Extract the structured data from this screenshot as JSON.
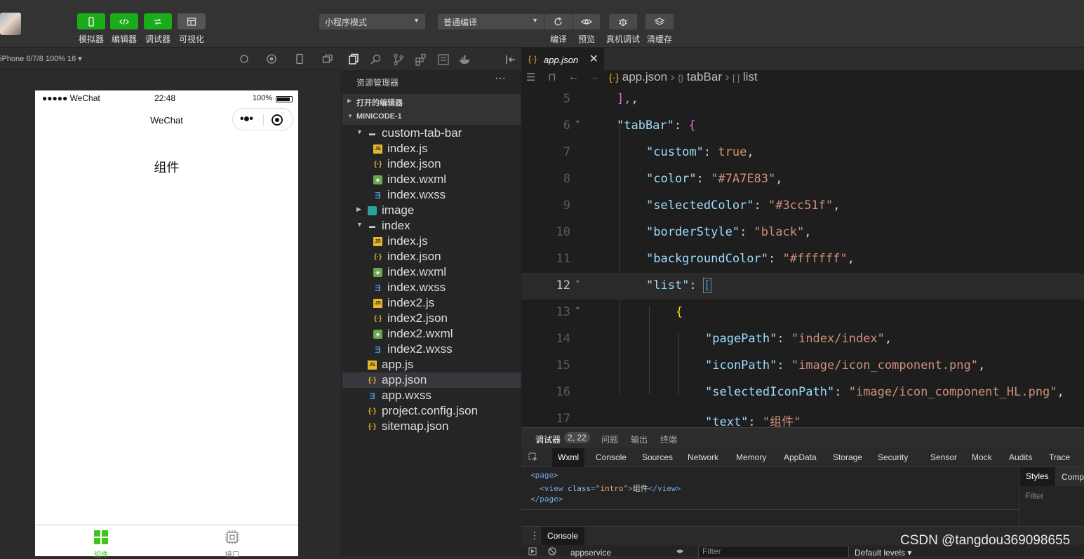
{
  "toolbar": {
    "buttons": [
      {
        "label": "模拟器",
        "icon": "phone-icon"
      },
      {
        "label": "编辑器",
        "icon": "code-icon"
      },
      {
        "label": "调试器",
        "icon": "debug-icon"
      },
      {
        "label": "可视化",
        "icon": "layout-icon"
      }
    ],
    "mode_select": "小程序模式",
    "compile_select": "普通编译",
    "actions": [
      {
        "label": "编译",
        "icon": "refresh-icon"
      },
      {
        "label": "预览",
        "icon": "eye-icon"
      },
      {
        "label": "真机调试",
        "icon": "bug-icon"
      },
      {
        "label": "清缓存",
        "icon": "layers-icon"
      }
    ]
  },
  "simulator": {
    "device": "iPhone 6/7/8 100% 16 ▾",
    "status": {
      "carrier": "●●●●● WeChat",
      "time": "22:48",
      "battery": "100%"
    },
    "nav_title": "WeChat",
    "content_text": "组件",
    "tabbar": [
      {
        "label": "组件",
        "color": "#3cc51f",
        "icon": "grid-icon"
      },
      {
        "label": "接口",
        "color": "#7A7E83",
        "icon": "chip-icon"
      }
    ]
  },
  "explorer": {
    "title": "资源管理器",
    "more": "···",
    "sections": [
      "打开的编辑器",
      "MINICODE-1"
    ],
    "tree": [
      {
        "name": "custom-tab-bar",
        "type": "folder",
        "level": 0,
        "expanded": true
      },
      {
        "name": "index.js",
        "type": "js",
        "level": 1
      },
      {
        "name": "index.json",
        "type": "json",
        "level": 1
      },
      {
        "name": "index.wxml",
        "type": "wxml",
        "level": 1
      },
      {
        "name": "index.wxss",
        "type": "wxss",
        "level": 1
      },
      {
        "name": "image",
        "type": "img",
        "level": 0,
        "expanded": false
      },
      {
        "name": "index",
        "type": "folder",
        "level": 0,
        "expanded": true
      },
      {
        "name": "index.js",
        "type": "js",
        "level": 1
      },
      {
        "name": "index.json",
        "type": "json",
        "level": 1
      },
      {
        "name": "index.wxml",
        "type": "wxml",
        "level": 1
      },
      {
        "name": "index.wxss",
        "type": "wxss",
        "level": 1
      },
      {
        "name": "index2.js",
        "type": "js",
        "level": 1
      },
      {
        "name": "index2.json",
        "type": "json",
        "level": 1
      },
      {
        "name": "index2.wxml",
        "type": "wxml",
        "level": 1
      },
      {
        "name": "index2.wxss",
        "type": "wxss",
        "level": 1
      },
      {
        "name": "app.js",
        "type": "js",
        "level": 0
      },
      {
        "name": "app.json",
        "type": "json",
        "level": 0,
        "selected": true
      },
      {
        "name": "app.wxss",
        "type": "wxss",
        "level": 0
      },
      {
        "name": "project.config.json",
        "type": "json",
        "level": 0
      },
      {
        "name": "sitemap.json",
        "type": "json",
        "level": 0
      }
    ]
  },
  "editor": {
    "tab": "app.json",
    "breadcrumb": [
      "app.json",
      "tabBar",
      "list"
    ],
    "lines": [
      {
        "n": "5",
        "indent": 1,
        "tokens": [
          [
            "br",
            "],"
          ],
          [
            "p",
            ","
          ]
        ]
      },
      {
        "n": "6",
        "indent": 1,
        "fold": true,
        "tokens": [
          [
            "k",
            "\"tabBar\""
          ],
          [
            "p",
            ": "
          ],
          [
            "br",
            "{"
          ]
        ]
      },
      {
        "n": "7",
        "indent": 2,
        "tokens": [
          [
            "k",
            "\"custom\""
          ],
          [
            "p",
            ": "
          ],
          [
            "b",
            "true"
          ],
          [
            "p",
            ","
          ]
        ]
      },
      {
        "n": "8",
        "indent": 2,
        "tokens": [
          [
            "k",
            "\"color\""
          ],
          [
            "p",
            ": "
          ],
          [
            "s",
            "\"#7A7E83\""
          ],
          [
            "p",
            ","
          ]
        ]
      },
      {
        "n": "9",
        "indent": 2,
        "tokens": [
          [
            "k",
            "\"selectedColor\""
          ],
          [
            "p",
            ": "
          ],
          [
            "s",
            "\"#3cc51f\""
          ],
          [
            "p",
            ","
          ]
        ]
      },
      {
        "n": "10",
        "indent": 2,
        "tokens": [
          [
            "k",
            "\"borderStyle\""
          ],
          [
            "p",
            ": "
          ],
          [
            "s",
            "\"black\""
          ],
          [
            "p",
            ","
          ]
        ]
      },
      {
        "n": "11",
        "indent": 2,
        "tokens": [
          [
            "k",
            "\"backgroundColor\""
          ],
          [
            "p",
            ": "
          ],
          [
            "s",
            "\"#ffffff\""
          ],
          [
            "p",
            ","
          ]
        ]
      },
      {
        "n": "12",
        "indent": 2,
        "fold": true,
        "current": true,
        "tokens": [
          [
            "k",
            "\"list\""
          ],
          [
            "p",
            ": "
          ],
          [
            "br3",
            "["
          ]
        ]
      },
      {
        "n": "13",
        "indent": 3,
        "fold": true,
        "tokens": [
          [
            "br2",
            "{"
          ]
        ]
      },
      {
        "n": "14",
        "indent": 4,
        "tokens": [
          [
            "k",
            "\"pagePath\""
          ],
          [
            "p",
            ": "
          ],
          [
            "s",
            "\"index/index\""
          ],
          [
            "p",
            ","
          ]
        ]
      },
      {
        "n": "15",
        "indent": 4,
        "tokens": [
          [
            "k",
            "\"iconPath\""
          ],
          [
            "p",
            ": "
          ],
          [
            "s",
            "\"image/icon_component.png\""
          ],
          [
            "p",
            ","
          ]
        ]
      },
      {
        "n": "16",
        "indent": 4,
        "tokens": [
          [
            "k",
            "\"selectedIconPath\""
          ],
          [
            "p",
            ": "
          ],
          [
            "s",
            "\"image/icon_component_HL.png\""
          ],
          [
            "p",
            ","
          ]
        ]
      },
      {
        "n": "17",
        "indent": 4,
        "tokens": [
          [
            "k",
            "\"text\""
          ],
          [
            "p",
            ": "
          ],
          [
            "s",
            "\"组件\""
          ]
        ]
      }
    ]
  },
  "debug": {
    "tabs": [
      "调试器",
      "问题",
      "输出",
      "终端"
    ],
    "position": "2, 22",
    "devtools_tabs": [
      "Wxml",
      "Console",
      "Sources",
      "Network",
      "Memory",
      "AppData",
      "Storage",
      "Security",
      "Sensor",
      "Mock",
      "Audits",
      "Trace"
    ],
    "wxml": [
      {
        "parts": [
          [
            "tag",
            "<page>"
          ]
        ]
      },
      {
        "parts": [
          [
            "tag",
            "  <view "
          ],
          [
            "attr",
            "class"
          ],
          [
            "tag",
            "="
          ],
          [
            "aval",
            "\"intro\""
          ],
          [
            "tag",
            ">"
          ],
          [
            "txt",
            "组件"
          ],
          [
            "tag",
            "</view>"
          ]
        ]
      },
      {
        "parts": [
          [
            "tag",
            "</page>"
          ]
        ]
      }
    ],
    "styles_tabs": [
      "Styles",
      "Comp"
    ],
    "styles_filter": "Filter",
    "console_tab": "Console",
    "console_context": "appservice",
    "console_filter": "Filter",
    "console_levels": "Default levels ▾"
  },
  "watermark": "CSDN @tangdou369098655",
  "colors": {
    "accent": "#1aad19",
    "selected": "#3cc51f",
    "unselected": "#7A7E83"
  }
}
